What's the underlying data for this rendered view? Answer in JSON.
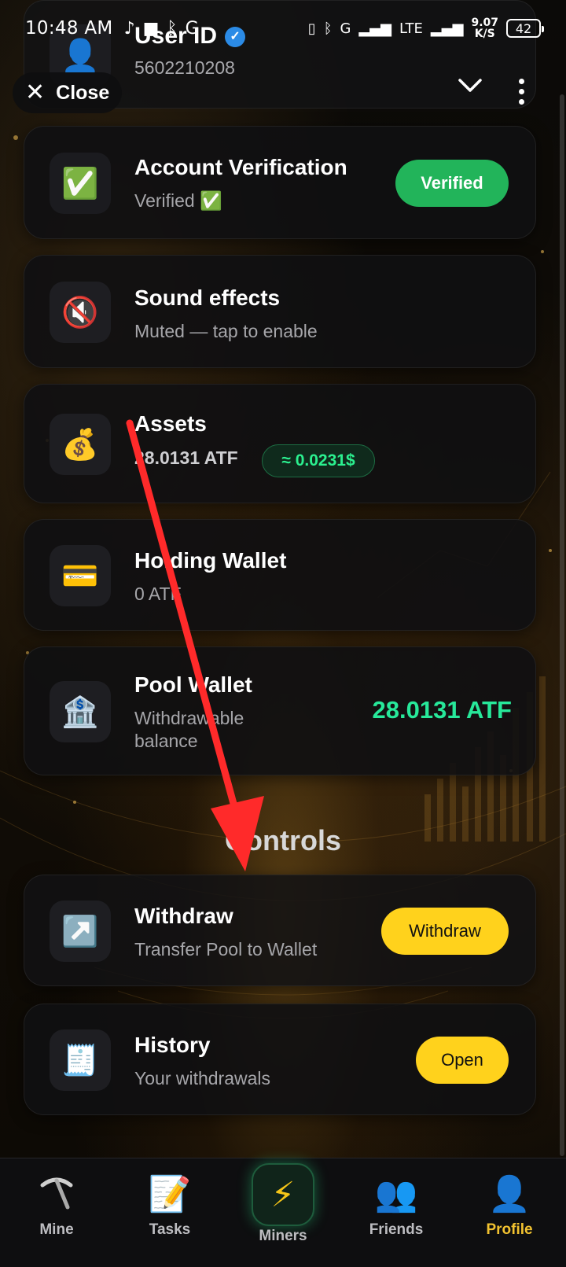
{
  "status_bar": {
    "time": "10:48 AM",
    "network": "G",
    "lte": "LTE",
    "speed_value": "9.07",
    "speed_unit": "K/S",
    "battery": "42"
  },
  "header": {
    "user_title": "User ID",
    "user_id": "5602210208",
    "close_label": "Close"
  },
  "cards": {
    "verification": {
      "icon": "✅",
      "title": "Account Verification",
      "subtitle": "Verified ✅",
      "button": "Verified"
    },
    "sound": {
      "icon": "🔇",
      "title": "Sound effects",
      "subtitle": "Muted — tap to enable"
    },
    "assets": {
      "icon": "💰",
      "title": "Assets",
      "amount": "28.0131 ATF",
      "usd": "≈ 0.0231$"
    },
    "holding": {
      "icon": "💳",
      "title": "Holding Wallet",
      "subtitle": "0 ATF"
    },
    "pool": {
      "icon": "🏦",
      "title": "Pool Wallet",
      "subtitle_line1": "Withdrawable",
      "subtitle_line2": "balance",
      "amount": "28.0131 ATF"
    }
  },
  "controls": {
    "section_title": "Controls",
    "withdraw": {
      "icon": "↗️",
      "title": "Withdraw",
      "subtitle": "Transfer Pool to Wallet",
      "button": "Withdraw"
    },
    "history": {
      "icon": "🧾",
      "title": "History",
      "subtitle": "Your withdrawals",
      "button": "Open"
    }
  },
  "bottom_nav": [
    {
      "label": "Mine",
      "icon": "pickaxe-icon"
    },
    {
      "label": "Tasks",
      "icon": "memo-icon"
    },
    {
      "label": "Miners",
      "icon": "lightning-icon"
    },
    {
      "label": "Friends",
      "icon": "friends-icon"
    },
    {
      "label": "Profile",
      "icon": "profile-icon",
      "active": true
    }
  ],
  "colors": {
    "verified_green": "#22b45a",
    "amount_green": "#27e89a",
    "button_yellow": "#ffd21c",
    "active_tab": "#f2c230",
    "annotation_arrow": "#ff2a2a"
  }
}
